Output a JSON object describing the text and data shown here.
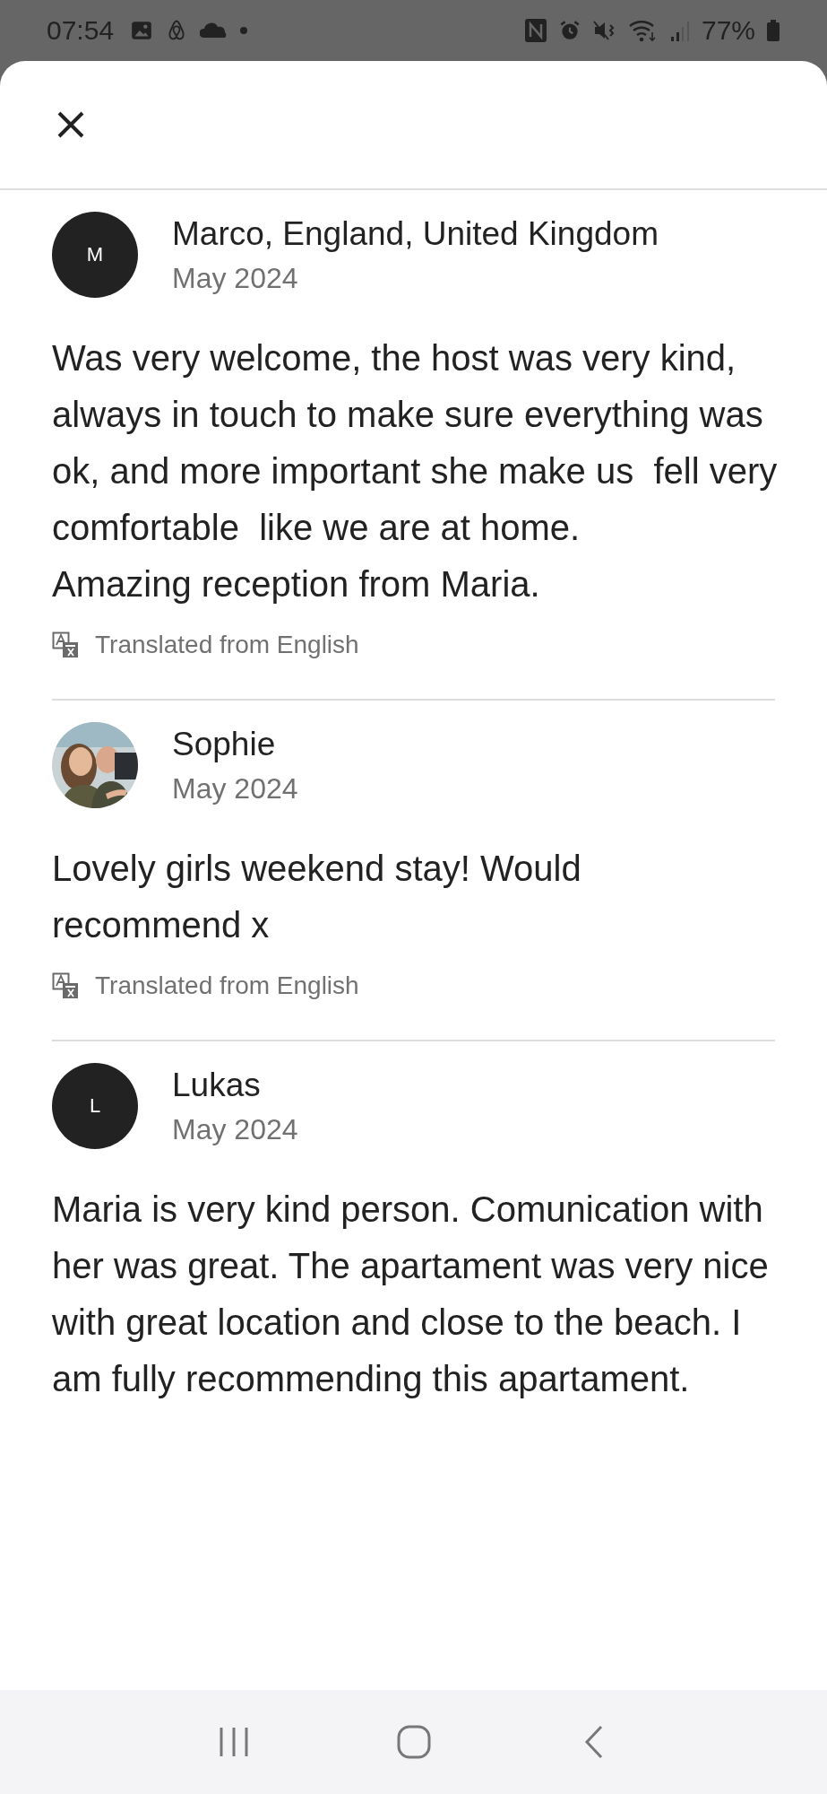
{
  "status_bar": {
    "time": "07:54",
    "battery": "77%"
  },
  "reviews": [
    {
      "name": "Marco, England, United Kingdom",
      "date": "May 2024",
      "avatar": {
        "kind": "initial",
        "initial": "M"
      },
      "text": "Was very welcome, the host was very kind, always in touch to make sure everything was ok, and more important she make us  fell very comfortable  like we are at home.\nAmazing reception from Maria.",
      "translation_note": "Translated from English"
    },
    {
      "name": "Sophie",
      "date": "May 2024",
      "text": "Lovely girls weekend stay! Would recommend x",
      "translation_note": "Translated from English"
    },
    {
      "name": "Lukas",
      "date": "May 2024",
      "avatar": {
        "kind": "initial",
        "initial": "L"
      },
      "text": "Maria is very kind person. Comunication with her was great. The apartament was very nice with great location and close to the beach. I am fully recommending this apartament."
    }
  ]
}
